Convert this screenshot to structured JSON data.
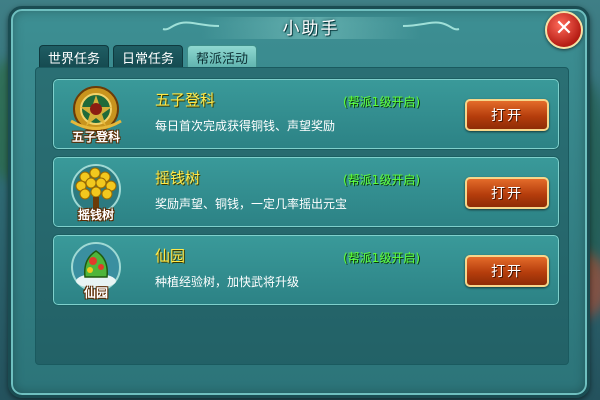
{
  "window": {
    "title": "小助手"
  },
  "tabs": [
    {
      "label": "世界任务",
      "active": false
    },
    {
      "label": "日常任务",
      "active": false
    },
    {
      "label": "帮派活动",
      "active": true
    }
  ],
  "activities": [
    {
      "name": "五子登科",
      "emblem_label": "五子登科",
      "emblem_icon": "five-sons-crest-icon",
      "description": "每日首次完成获得铜钱、声望奖励",
      "requirement": "(帮派1级开启)",
      "button_label": "打开"
    },
    {
      "name": "摇钱树",
      "emblem_label": "摇钱树",
      "emblem_icon": "money-tree-icon",
      "description": "奖励声望、铜钱，一定几率摇出元宝",
      "requirement": "(帮派1级开启)",
      "button_label": "打开"
    },
    {
      "name": "仙园",
      "emblem_label": "仙园",
      "emblem_icon": "fairy-garden-icon",
      "description": "种植经验树，加快武将升级",
      "requirement": "(帮派1级开启)",
      "button_label": "打开"
    }
  ],
  "colors": {
    "panel": "#2c7479",
    "title_text": "#ffe94a",
    "requirement_text": "#5dff3a",
    "button": "#b53d0c"
  }
}
